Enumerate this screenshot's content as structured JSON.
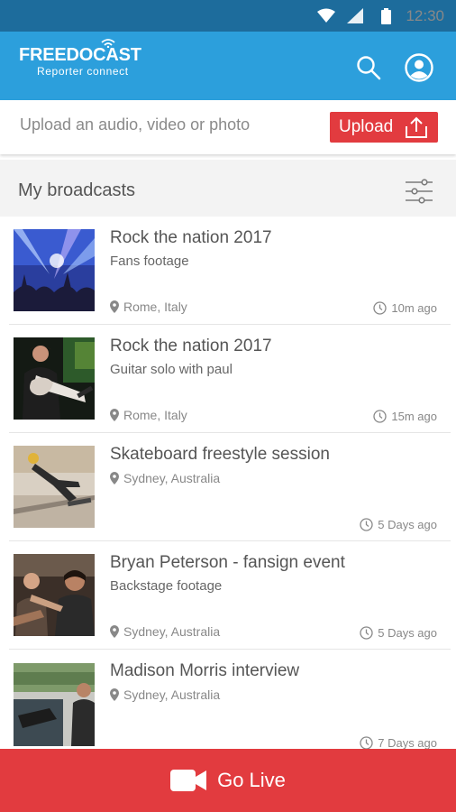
{
  "status_bar": {
    "time": "12:30"
  },
  "app_bar": {
    "logo_brand": "FREEDOCAST",
    "logo_sub": "Reporter connect",
    "icons": [
      "search-icon",
      "account-icon"
    ]
  },
  "upload": {
    "placeholder": "Upload an audio, video or photo",
    "button_label": "Upload"
  },
  "section": {
    "title": "My broadcasts"
  },
  "broadcasts": [
    {
      "title": "Rock the nation 2017",
      "subtitle": "Fans footage",
      "location": "Rome, Italy",
      "time": "10m ago"
    },
    {
      "title": "Rock the nation 2017",
      "subtitle": "Guitar solo with paul",
      "location": "Rome, Italy",
      "time": "15m ago"
    },
    {
      "title": "Skateboard freestyle session",
      "subtitle": "",
      "location": "Sydney, Australia",
      "time": "5 Days ago"
    },
    {
      "title": "Bryan Peterson - fansign event",
      "subtitle": "Backstage footage",
      "location": "Sydney, Australia",
      "time": "5 Days ago"
    },
    {
      "title": "Madison Morris interview",
      "subtitle": "",
      "location": "Sydney, Australia",
      "time": "7 Days ago"
    }
  ],
  "go_live": {
    "label": "Go Live"
  },
  "colors": {
    "status_bar": "#1d6c9c",
    "app_bar": "#2c9fdc",
    "accent_red": "#e23b3f"
  }
}
